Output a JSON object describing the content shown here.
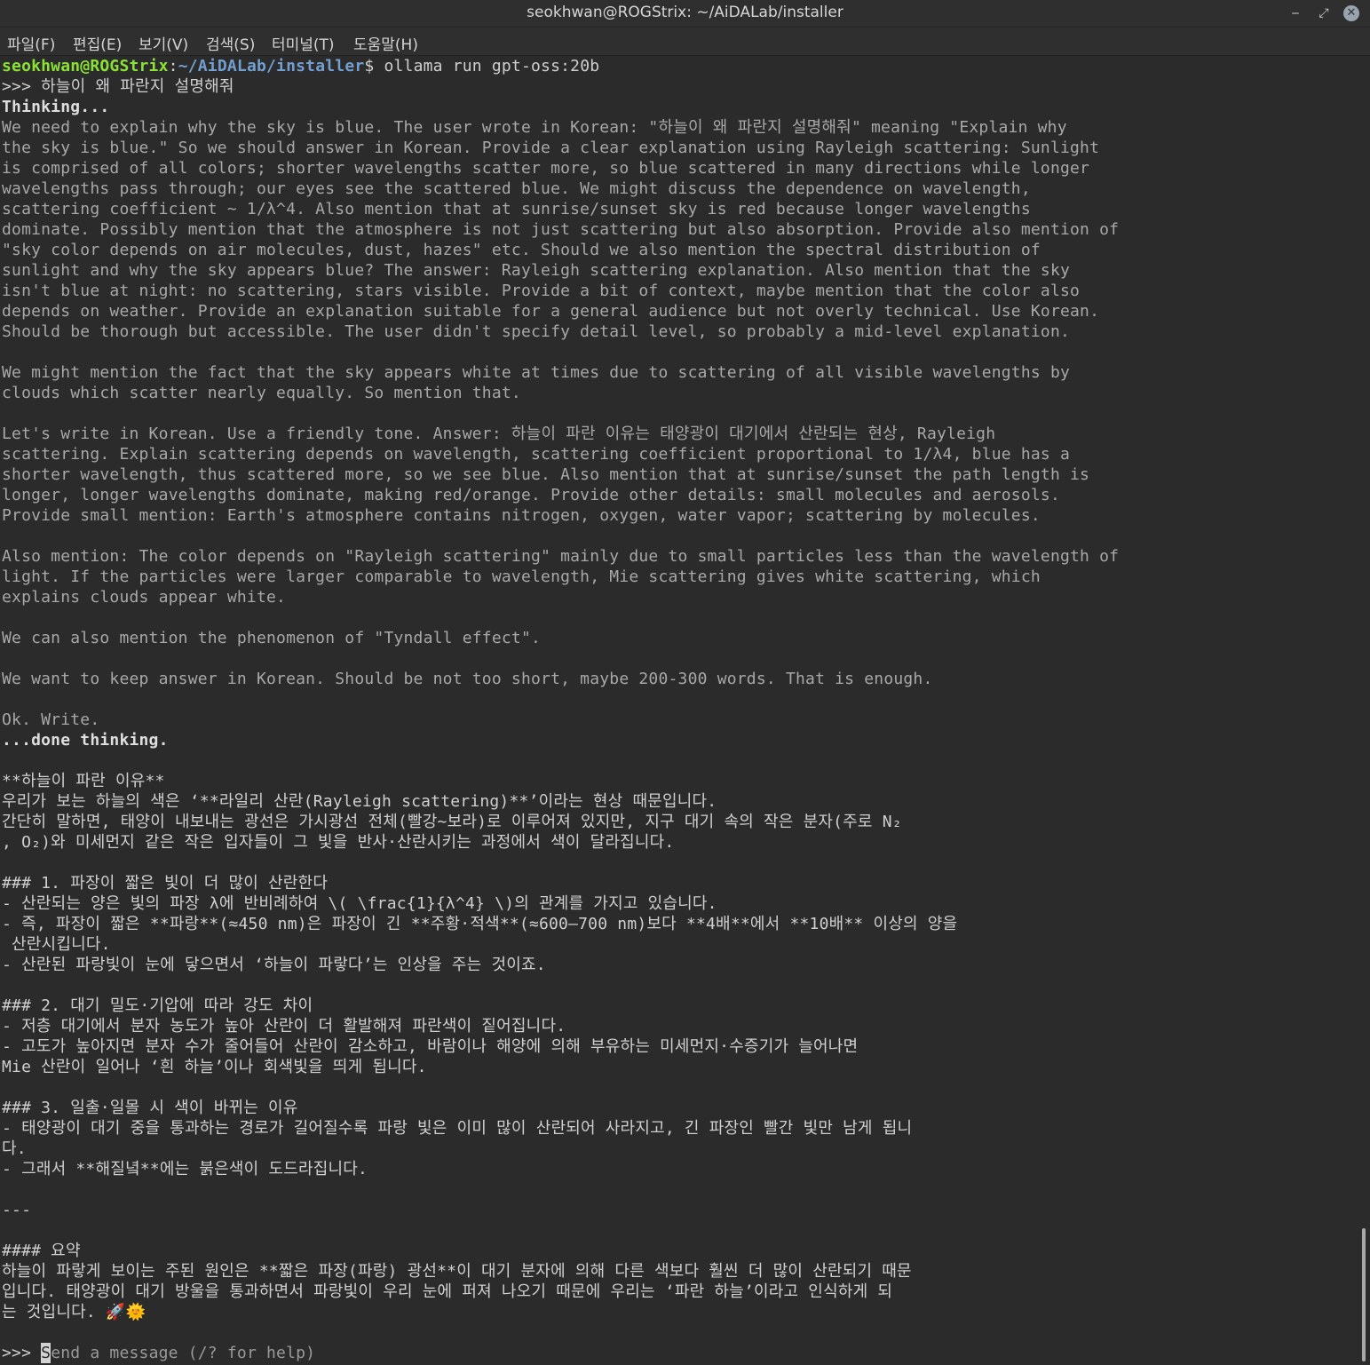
{
  "window": {
    "title": "seokhwan@ROGStrix: ~/AiDALab/installer",
    "minimize_icon": "minimize-icon",
    "maximize_icon": "restore-icon",
    "close_icon": "close-icon"
  },
  "menu": {
    "file": "파일(F)",
    "edit": "편집(E)",
    "view": "보기(V)",
    "search": "검색(S)",
    "terminal": "터미널(T)",
    "help": "도움말(H)"
  },
  "colors": {
    "background": "#2b2b2b",
    "prompt_user": "#8ae234",
    "prompt_path": "#729fcf",
    "text": "#cfcfcf"
  },
  "prompt": {
    "user": "seokhwan@ROGStrix",
    "sep": ":",
    "path": "~/AiDALab/installer",
    "dollar": "$ ",
    "command": "ollama run gpt-oss:20b"
  },
  "lines": [
    {
      "t": ">>> 하늘이 왜 파란지 설명해줘",
      "s": ""
    },
    {
      "t": "Thinking...",
      "s": "bold"
    },
    {
      "t": "We need to explain why the sky is blue. The user wrote in Korean: \"하늘이 왜 파란지 설명해줘\" meaning \"Explain why",
      "s": "thinking"
    },
    {
      "t": "the sky is blue.\" So we should answer in Korean. Provide a clear explanation using Rayleigh scattering: Sunlight",
      "s": "thinking"
    },
    {
      "t": "is comprised of all colors; shorter wavelengths scatter more, so blue scattered in many directions while longer",
      "s": "thinking"
    },
    {
      "t": "wavelengths pass through; our eyes see the scattered blue. We might discuss the dependence on wavelength,",
      "s": "thinking"
    },
    {
      "t": "scattering coefficient ~ 1/λ^4. Also mention that at sunrise/sunset sky is red because longer wavelengths",
      "s": "thinking"
    },
    {
      "t": "dominate. Possibly mention that the atmosphere is not just scattering but also absorption. Provide also mention of",
      "s": "thinking"
    },
    {
      "t": "\"sky color depends on air molecules, dust, hazes\" etc. Should we also mention the spectral distribution of",
      "s": "thinking"
    },
    {
      "t": "sunlight and why the sky appears blue? The answer: Rayleigh scattering explanation. Also mention that the sky",
      "s": "thinking"
    },
    {
      "t": "isn't blue at night: no scattering, stars visible. Provide a bit of context, maybe mention that the color also",
      "s": "thinking"
    },
    {
      "t": "depends on weather. Provide an explanation suitable for a general audience but not overly technical. Use Korean.",
      "s": "thinking"
    },
    {
      "t": "Should be thorough but accessible. The user didn't specify detail level, so probably a mid-level explanation.",
      "s": "thinking"
    },
    {
      "t": "",
      "s": ""
    },
    {
      "t": "We might mention the fact that the sky appears white at times due to scattering of all visible wavelengths by",
      "s": "thinking"
    },
    {
      "t": "clouds which scatter nearly equally. So mention that.",
      "s": "thinking"
    },
    {
      "t": "",
      "s": ""
    },
    {
      "t": "Let's write in Korean. Use a friendly tone. Answer: 하늘이 파란 이유는 태양광이 대기에서 산란되는 현상, Rayleigh",
      "s": "thinking"
    },
    {
      "t": "scattering. Explain scattering depends on wavelength, scattering coefficient proportional to 1/λ4, blue has a",
      "s": "thinking"
    },
    {
      "t": "shorter wavelength, thus scattered more, so we see blue. Also mention that at sunrise/sunset the path length is",
      "s": "thinking"
    },
    {
      "t": "longer, longer wavelengths dominate, making red/orange. Provide other details: small molecules and aerosols.",
      "s": "thinking"
    },
    {
      "t": "Provide small mention: Earth's atmosphere contains nitrogen, oxygen, water vapor; scattering by molecules.",
      "s": "thinking"
    },
    {
      "t": "",
      "s": ""
    },
    {
      "t": "Also mention: The color depends on \"Rayleigh scattering\" mainly due to small particles less than the wavelength of",
      "s": "thinking"
    },
    {
      "t": "light. If the particles were larger comparable to wavelength, Mie scattering gives white scattering, which",
      "s": "thinking"
    },
    {
      "t": "explains clouds appear white.",
      "s": "thinking"
    },
    {
      "t": "",
      "s": ""
    },
    {
      "t": "We can also mention the phenomenon of \"Tyndall effect\".",
      "s": "thinking"
    },
    {
      "t": "",
      "s": ""
    },
    {
      "t": "We want to keep answer in Korean. Should be not too short, maybe 200-300 words. That is enough.",
      "s": "thinking"
    },
    {
      "t": "",
      "s": ""
    },
    {
      "t": "Ok. Write.",
      "s": "thinking"
    },
    {
      "t": "...done thinking.",
      "s": "bold"
    },
    {
      "t": "",
      "s": ""
    },
    {
      "t": "**하늘이 파란 이유**",
      "s": ""
    },
    {
      "t": "우리가 보는 하늘의 색은 ‘**라일리 산란(Rayleigh scattering)**’이라는 현상 때문입니다.",
      "s": ""
    },
    {
      "t": "간단히 말하면, 태양이 내보내는 광선은 가시광선 전체(빨강~보라)로 이루어져 있지만, 지구 대기 속의 작은 분자(주로 N₂",
      "s": ""
    },
    {
      "t": ", O₂)와 미세먼지 같은 작은 입자들이 그 빛을 반사·산란시키는 과정에서 색이 달라집니다.",
      "s": ""
    },
    {
      "t": "",
      "s": ""
    },
    {
      "t": "### 1. 파장이 짧은 빛이 더 많이 산란한다",
      "s": ""
    },
    {
      "t": "- 산란되는 양은 빛의 파장 λ에 반비례하여 \\( \\frac{1}{λ^4} \\)의 관계를 가지고 있습니다.",
      "s": ""
    },
    {
      "t": "- 즉, 파장이 짧은 **파랑**(≈450 nm)은 파장이 긴 **주황·적색**(≈600–700 nm)보다 **4배**에서 **10배** 이상의 양을",
      "s": ""
    },
    {
      "t": " 산란시킵니다.",
      "s": ""
    },
    {
      "t": "- 산란된 파랑빛이 눈에 닿으면서 ‘하늘이 파랗다’는 인상을 주는 것이죠.",
      "s": ""
    },
    {
      "t": "",
      "s": ""
    },
    {
      "t": "### 2. 대기 밀도·기압에 따라 강도 차이",
      "s": ""
    },
    {
      "t": "- 저층 대기에서 분자 농도가 높아 산란이 더 활발해져 파란색이 짙어집니다.",
      "s": ""
    },
    {
      "t": "- 고도가 높아지면 분자 수가 줄어들어 산란이 감소하고, 바람이나 해양에 의해 부유하는 미세먼지·수증기가 늘어나면",
      "s": ""
    },
    {
      "t": "Mie 산란이 일어나 ‘흰 하늘’이나 회색빛을 띄게 됩니다.",
      "s": ""
    },
    {
      "t": "",
      "s": ""
    },
    {
      "t": "### 3. 일출·일몰 시 색이 바뀌는 이유",
      "s": ""
    },
    {
      "t": "- 태양광이 대기 중을 통과하는 경로가 길어질수록 파랑 빛은 이미 많이 산란되어 사라지고, 긴 파장인 빨간 빛만 남게 됩니",
      "s": ""
    },
    {
      "t": "다.",
      "s": ""
    },
    {
      "t": "- 그래서 **해질녘**에는 붉은색이 도드라집니다.",
      "s": ""
    },
    {
      "t": "",
      "s": ""
    },
    {
      "t": "---",
      "s": ""
    },
    {
      "t": "",
      "s": ""
    },
    {
      "t": "#### 요약",
      "s": ""
    },
    {
      "t": "하늘이 파랗게 보이는 주된 원인은 **짧은 파장(파랑) 광선**이 대기 분자에 의해 다른 색보다 훨씬 더 많이 산란되기 때문",
      "s": ""
    },
    {
      "t": "입니다. 태양광이 대기 방울을 통과하면서 파랑빛이 우리 눈에 퍼져 나오기 때문에 우리는 ‘파란 하늘’이라고 인식하게 되",
      "s": ""
    },
    {
      "t": "는 것입니다. 🚀🌞",
      "s": ""
    },
    {
      "t": "",
      "s": ""
    }
  ],
  "input": {
    "prompt": ">>> ",
    "cursor_char": "S",
    "placeholder_rest": "end a message (/? for help)"
  }
}
